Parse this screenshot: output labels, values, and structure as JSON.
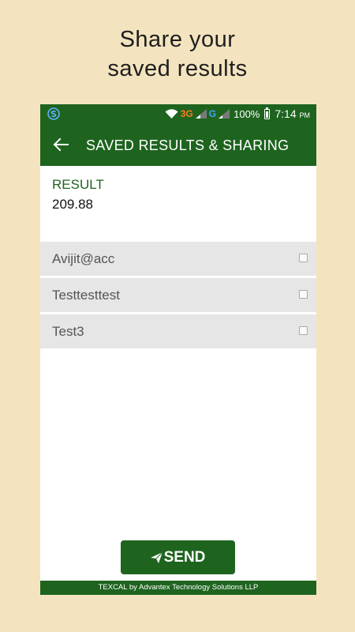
{
  "promo": {
    "line1": "Share your",
    "line2": "saved results"
  },
  "statusbar": {
    "app_icon": "sync-s-icon",
    "wifi_icon": "wifi-icon",
    "network_3g": "3G",
    "network_g": "G",
    "battery_percent": "100%",
    "time": "7:14",
    "time_suffix": "PM"
  },
  "toolbar": {
    "back_icon": "back-arrow-icon",
    "title": "SAVED RESULTS & SHARING"
  },
  "result": {
    "label": "RESULT",
    "value": "209.88"
  },
  "contacts": [
    {
      "name": "Avijit@acc",
      "checked": false
    },
    {
      "name": "Testtesttest",
      "checked": false
    },
    {
      "name": "Test3",
      "checked": false
    }
  ],
  "send_button": {
    "label": "SEND",
    "icon": "paper-plane-icon"
  },
  "footer": {
    "text": "TEXCAL by Advantex Technology Solutions LLP"
  },
  "colors": {
    "primary": "#1e641f",
    "background": "#f3e4bf",
    "list_item": "#e6e6e6"
  }
}
